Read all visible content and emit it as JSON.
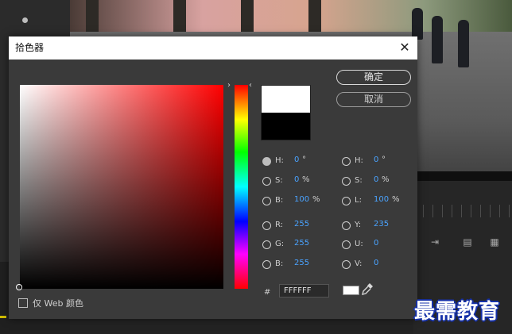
{
  "dialog": {
    "title": "拾色器",
    "ok_label": "确定",
    "cancel_label": "取消",
    "selected_mode": "H",
    "hsb": [
      {
        "label": "H:",
        "value": "0",
        "unit": "°"
      },
      {
        "label": "S:",
        "value": "0",
        "unit": "%"
      },
      {
        "label": "B:",
        "value": "100",
        "unit": "%"
      }
    ],
    "rgb": [
      {
        "label": "R:",
        "value": "255"
      },
      {
        "label": "G:",
        "value": "255"
      },
      {
        "label": "B:",
        "value": "255"
      }
    ],
    "hsl": [
      {
        "label": "H:",
        "value": "0",
        "unit": "°"
      },
      {
        "label": "S:",
        "value": "0",
        "unit": "%"
      },
      {
        "label": "L:",
        "value": "100",
        "unit": "%"
      }
    ],
    "yuv": [
      {
        "label": "Y:",
        "value": "235"
      },
      {
        "label": "U:",
        "value": "0"
      },
      {
        "label": "V:",
        "value": "0"
      }
    ],
    "hex_prefix": "#",
    "hex_value": "FFFFFF",
    "web_only_label": "仅 Web 颜色",
    "web_only_checked": false,
    "new_color": "#ffffff",
    "old_color": "#000000"
  },
  "watermark": "最需教育",
  "icons": [
    "close-icon",
    "eyedropper-icon",
    "hue-arrow-left-icon",
    "hue-arrow-right-icon"
  ]
}
